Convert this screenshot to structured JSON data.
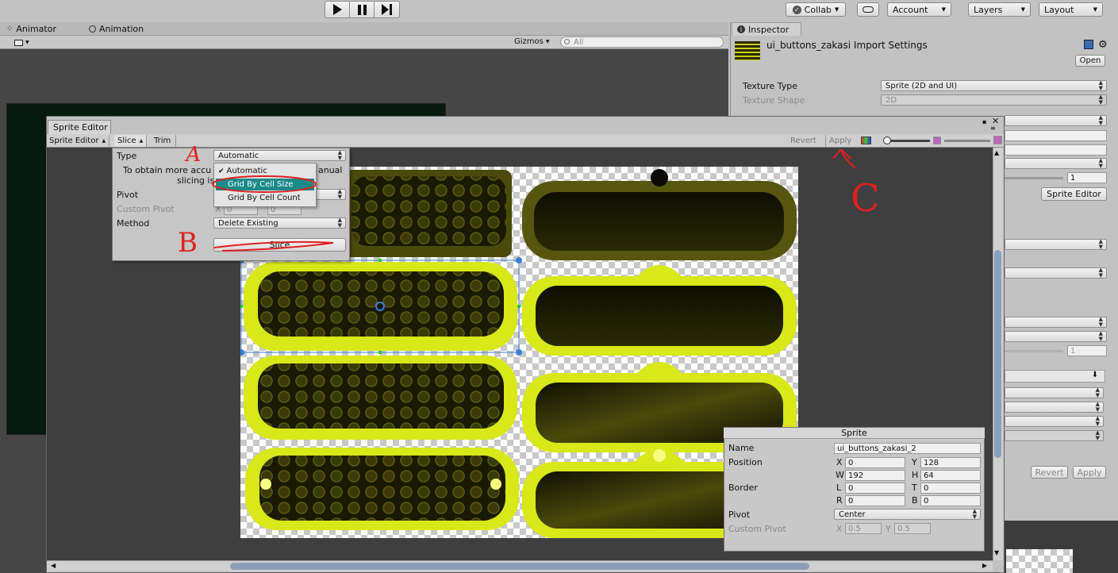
{
  "toolbar": {
    "play_icon": "play-icon",
    "pause_icon": "pause-icon",
    "step_icon": "step-icon",
    "collab_label": "Collab",
    "account_label": "Account",
    "layers_label": "Layers",
    "layout_label": "Layout"
  },
  "scene_tabs": {
    "animator": "Animator",
    "animation": "Animation",
    "gizmos": "Gizmos",
    "search_placeholder": "All"
  },
  "inspector": {
    "tab": "Inspector",
    "title": "ui_buttons_zakasi Import Settings",
    "open_label": "Open",
    "texture_type_label": "Texture Type",
    "texture_type_value": "Sprite (2D and UI)",
    "texture_shape_label": "Texture Shape",
    "texture_shape_value": "2D",
    "pixels_value": "1",
    "sprite_editor_label": "Sprite Editor",
    "slider_value": "1",
    "revert_label": "Revert",
    "apply_label": "Apply"
  },
  "sprite_editor": {
    "window_title": "Sprite Editor",
    "mode_menu": "Sprite Editor",
    "slice_menu": "Slice",
    "trim_label": "Trim",
    "revert_label": "Revert",
    "apply_label": "Apply"
  },
  "slice_panel": {
    "type_label": "Type",
    "type_value": "Automatic",
    "info_left": "To obtain more accu",
    "info_right": "anual",
    "info_line2": "slicing is",
    "pivot_label": "Pivot",
    "custom_pivot_label": "Custom Pivot",
    "custom_pivot_x": "X",
    "custom_pivot_x_value": "0",
    "custom_pivot_y_value": "0",
    "method_label": "Method",
    "method_value": "Delete Existing",
    "slice_button": "Slice",
    "options": [
      "Automatic",
      "Grid By Cell Size",
      "Grid By Cell Count"
    ],
    "selected_option": "Automatic",
    "highlighted_option": "Grid By Cell Size"
  },
  "annotations": {
    "a": "A",
    "b": "B",
    "c": "C",
    "color": "#e02020"
  },
  "sprite_panel": {
    "title": "Sprite",
    "name_label": "Name",
    "name_value": "ui_buttons_zakasi_2",
    "position_label": "Position",
    "x_label": "X",
    "x_value": "0",
    "y_label": "Y",
    "y_value": "128",
    "w_label": "W",
    "w_value": "192",
    "h_label": "H",
    "h_value": "64",
    "border_label": "Border",
    "l_label": "L",
    "l_value": "0",
    "t_label": "T",
    "t_value": "0",
    "r_label": "R",
    "r_value": "0",
    "b_label": "B",
    "b_value": "0",
    "pivot_label": "Pivot",
    "pivot_value": "Center",
    "custom_pivot_label": "Custom Pivot",
    "cp_x_label": "X",
    "cp_x_value": "0.5",
    "cp_y_label": "Y",
    "cp_y_value": "0.5"
  },
  "colors": {
    "accent_teal": "#1a8a8a",
    "glow_yellow": "#d8e818",
    "dark_olive": "#3a3a06",
    "selection_blue": "#3a7fd8"
  }
}
